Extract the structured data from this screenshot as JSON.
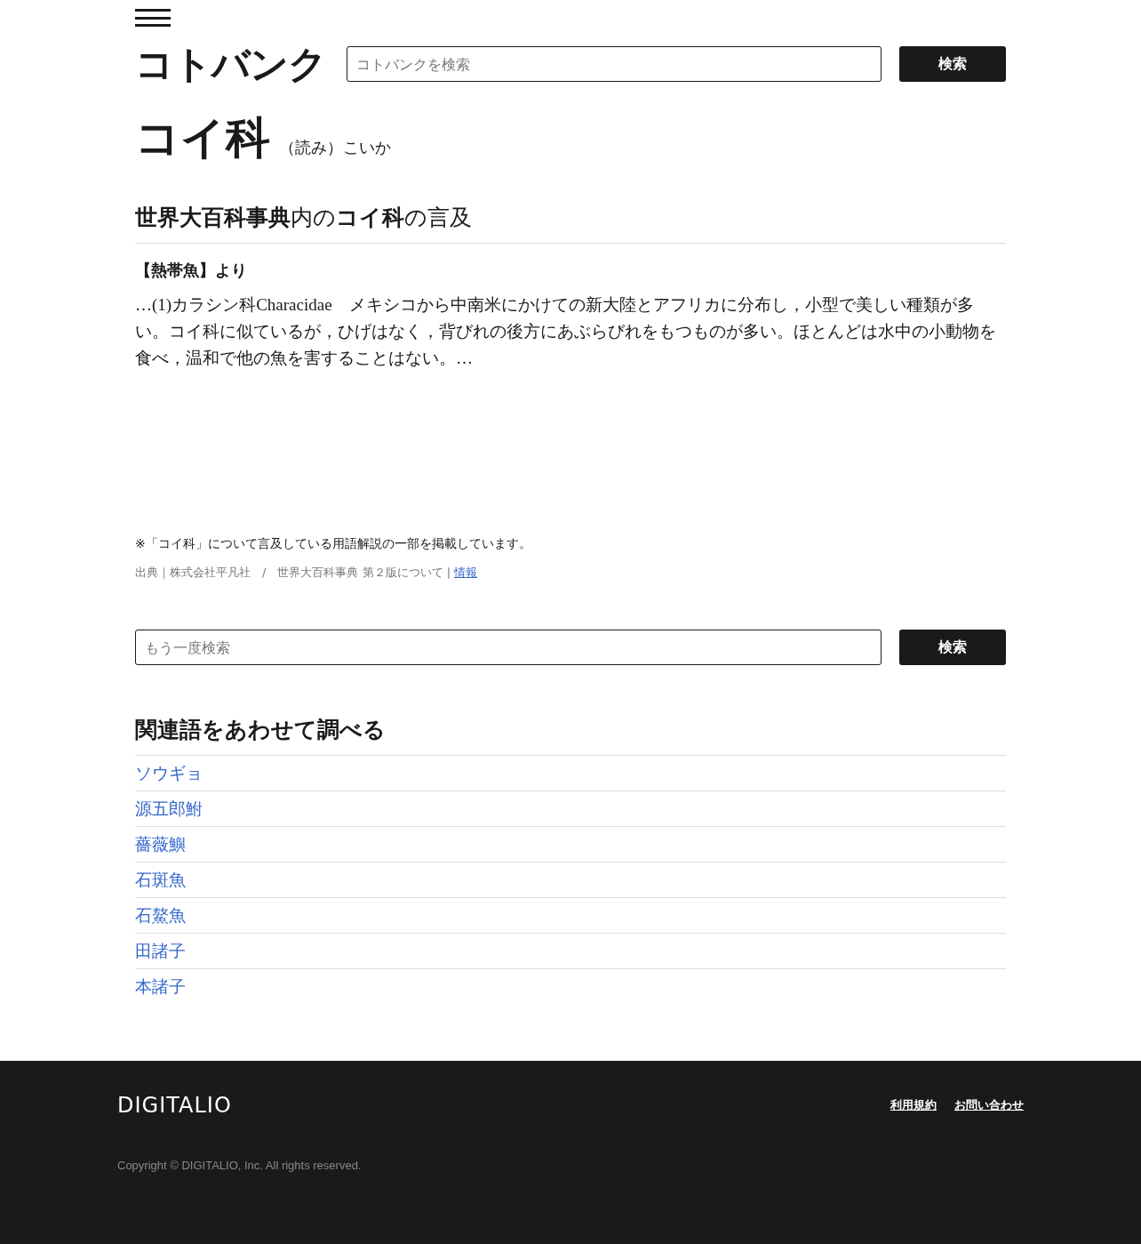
{
  "header": {
    "logo": "コトバンク",
    "search": {
      "placeholder": "コトバンクを検索"
    },
    "search_button": "検索"
  },
  "entry": {
    "title": "コイ科",
    "reading": "（読み）こいか"
  },
  "mention": {
    "heading": "**世界大百科事典**内の**コイ科**の言及",
    "source_title": "【熱帯魚】より",
    "excerpt": "…(1)カラシン科Characidae　メキシコから中南米にかけての新大陸とアフリカに分布し，小型で美しい種類が多い。コイ科に似ているが，ひげはなく，背びれの後方にあぶらびれをもつものが多い。ほとんどは水中の小動物を食べ，温和で他の魚を害することはない。…"
  },
  "note": "※「コイ科」について言及している用語解説の一部を掲載しています。",
  "credit": {
    "text": "出典｜株式会社平凡社　/　世界大百科事典 第２版について |",
    "link": "情報"
  },
  "search_again": {
    "placeholder": "もう一度検索",
    "button": "検索"
  },
  "related": {
    "heading": "関連語をあわせて調べる",
    "items": [
      "ソウギョ",
      "源五郎鮒",
      "薔薇鱮",
      "石斑魚",
      "石鰲魚",
      "田諸子",
      "本諸子"
    ]
  },
  "footer": {
    "logo": "DIGITALIO",
    "links": [
      "利用規約",
      "お問い合わせ"
    ],
    "copyright": "Copyright © DIGITALIO, Inc. All rights reserved."
  }
}
